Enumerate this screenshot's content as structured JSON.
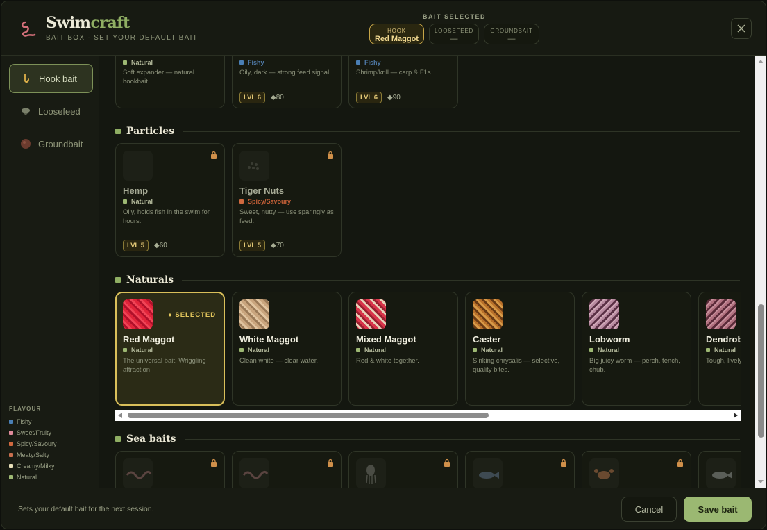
{
  "app": {
    "brand_a": "Swim",
    "brand_b": "craft",
    "subtitle": "BAIT BOX · SET YOUR DEFAULT BAIT"
  },
  "bait_selected": {
    "label": "BAIT SELECTED",
    "chips": [
      {
        "key": "HOOK",
        "value": "Red Maggot",
        "active": true
      },
      {
        "key": "LOOSEFEED",
        "value": "—",
        "active": false
      },
      {
        "key": "GROUNDBAIT",
        "value": "—",
        "active": false
      }
    ]
  },
  "close_icon": "close-icon",
  "sidebar": {
    "items": [
      {
        "label": "Hook bait",
        "icon": "hook-icon",
        "active": true
      },
      {
        "label": "Loosefeed",
        "icon": "loosefeed-icon",
        "active": false
      },
      {
        "label": "Groundbait",
        "icon": "groundbait-icon",
        "active": false
      }
    ],
    "flavour_title": "FLAVOUR",
    "flavours": [
      {
        "name": "Fishy",
        "color": "#4a7fb5"
      },
      {
        "name": "Sweet/Fruity",
        "color": "#e08a9b"
      },
      {
        "name": "Spicy/Savoury",
        "color": "#d0693f"
      },
      {
        "name": "Meaty/Salty",
        "color": "#c9704f"
      },
      {
        "name": "Creamy/Milky",
        "color": "#e7dfb8"
      },
      {
        "name": "Natural",
        "color": "#9db873"
      }
    ]
  },
  "top_cards": [
    {
      "flavour": "Natural",
      "desc": "Soft expander — natural hookbait.",
      "lvl": "",
      "price": ""
    },
    {
      "flavour": "Fishy",
      "desc": "Oily, dark — strong feed signal.",
      "lvl": "LVL 6",
      "price": "◆80"
    },
    {
      "flavour": "Fishy",
      "desc": "Shrimp/krill — carp & F1s.",
      "lvl": "LVL 6",
      "price": "◆90"
    }
  ],
  "sections": {
    "particles": {
      "title": "Particles",
      "cards": [
        {
          "name": "Hemp",
          "flavour": "Natural",
          "desc": "Oily, holds fish in the swim for hours.",
          "lvl": "LVL 5",
          "price": "◆60"
        },
        {
          "name": "Tiger Nuts",
          "flavour": "Spicy/Savoury",
          "desc": "Sweet, nutty — use sparingly as feed.",
          "lvl": "LVL 5",
          "price": "◆70"
        }
      ]
    },
    "naturals": {
      "title": "Naturals",
      "selected_badge": "● SELECTED",
      "cards": [
        {
          "name": "Red Maggot",
          "flavour": "Natural",
          "desc": "The universal bait. Wriggling attraction."
        },
        {
          "name": "White Maggot",
          "flavour": "Natural",
          "desc": "Clean white — clear water."
        },
        {
          "name": "Mixed Maggot",
          "flavour": "Natural",
          "desc": "Red & white together."
        },
        {
          "name": "Caster",
          "flavour": "Natural",
          "desc": "Sinking chrysalis — selective, quality bites."
        },
        {
          "name": "Lobworm",
          "flavour": "Natural",
          "desc": "Big juicy worm — perch, tench, chub."
        },
        {
          "name": "Dendrob",
          "flavour": "Natural",
          "desc": "Tough, lively"
        }
      ]
    },
    "sea": {
      "title": "Sea baits"
    }
  },
  "footer": {
    "note": "Sets your default bait for the next session.",
    "cancel": "Cancel",
    "save": "Save bait"
  }
}
